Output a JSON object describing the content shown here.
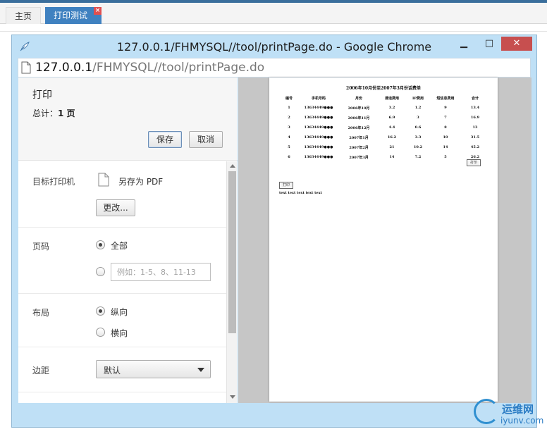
{
  "app": {
    "tabs": [
      {
        "label": "主页"
      },
      {
        "label": "打印测试",
        "close": "×"
      }
    ]
  },
  "window": {
    "title": "127.0.0.1/FHMYSQL//tool/printPage.do - Google Chrome",
    "url_host": "127.0.0.1",
    "url_path": "/FHMYSQL//tool/printPage.do",
    "minimize": "▭",
    "maximize": "□",
    "close": "✕"
  },
  "print": {
    "title": "打印",
    "total_label": "总计：",
    "total_value": "1 页",
    "save_label": "保存",
    "cancel_label": "取消",
    "destination_label": "目标打印机",
    "destination_value": "另存为 PDF",
    "change_label": "更改...",
    "pages_label": "页码",
    "pages_all": "全部",
    "pages_placeholder": "例如：1-5、8、11-13",
    "layout_label": "布局",
    "layout_portrait": "纵向",
    "layout_landscape": "横向",
    "margins_label": "边距",
    "margins_value": "默认"
  },
  "preview": {
    "title": "2006年10月份至2007年3月份话费单",
    "headers": [
      "编号",
      "手机号码",
      "月份",
      "通话费用",
      "IP费用",
      "短信息费用",
      "合计"
    ],
    "rows": [
      [
        "1",
        "13634449●●●",
        "2006年10月",
        "3.2",
        "1.2",
        "9",
        "13.4"
      ],
      [
        "2",
        "13634449●●●",
        "2006年11月",
        "6.9",
        "3",
        "7",
        "16.9"
      ],
      [
        "3",
        "13634449●●●",
        "2006年12月",
        "4.4",
        "0.6",
        "8",
        "13"
      ],
      [
        "4",
        "13634449●●●",
        "2007年1月",
        "16.2",
        "3.3",
        "10",
        "31.5"
      ],
      [
        "5",
        "13634449●●●",
        "2007年2月",
        "21",
        "10.2",
        "14",
        "45.2"
      ],
      [
        "6",
        "13634449●●●",
        "2007年3月",
        "14",
        "7.2",
        "5",
        "26.2"
      ]
    ],
    "print_button": "打印",
    "print_button_2": "打印",
    "text_line": "text text text text text"
  },
  "watermark": {
    "cn": "运维网",
    "en": "iyunv.com"
  }
}
